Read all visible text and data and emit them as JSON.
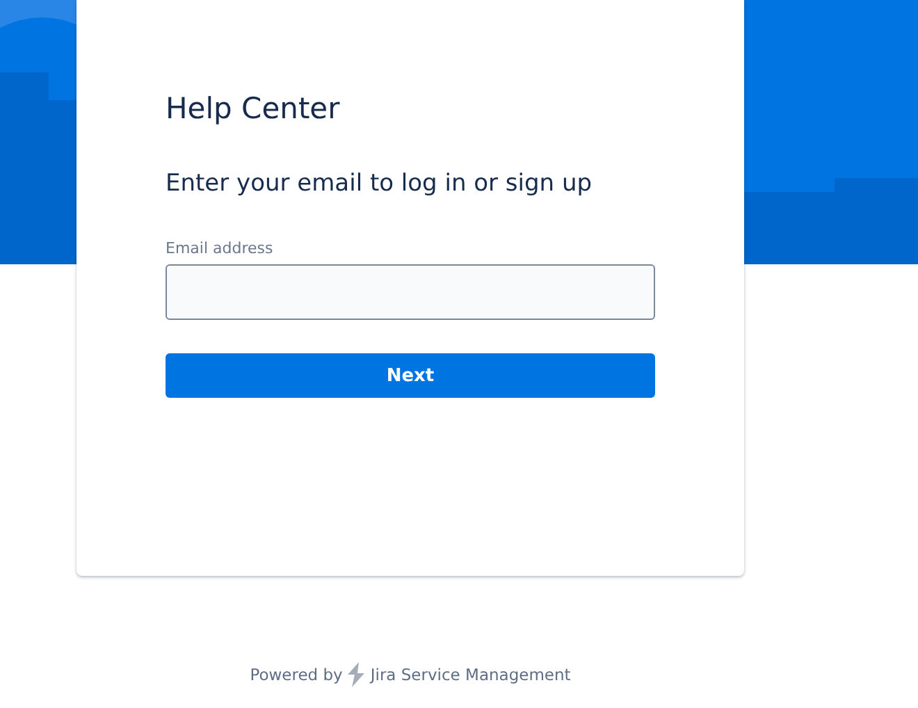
{
  "card": {
    "title": "Help Center",
    "heading": "Enter your email to log in or sign up",
    "email_field": {
      "label": "Email address"
    },
    "button": "Next"
  },
  "footer": {
    "prefix": "Powered by",
    "product": "Jira Service Management"
  }
}
